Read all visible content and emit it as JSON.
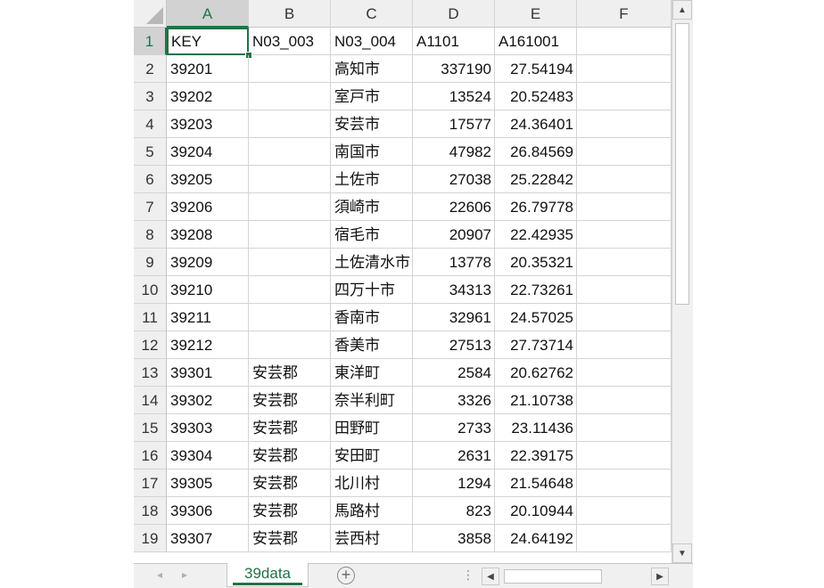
{
  "columns": [
    "A",
    "B",
    "C",
    "D",
    "E",
    "F"
  ],
  "selected_column": "A",
  "selected_row": 1,
  "header_row": [
    "KEY",
    "N03_003",
    "N03_004",
    "A1101",
    "A161001",
    ""
  ],
  "rows": [
    [
      "39201",
      "",
      "高知市",
      "337190",
      "27.54194"
    ],
    [
      "39202",
      "",
      "室戸市",
      "13524",
      "20.52483"
    ],
    [
      "39203",
      "",
      "安芸市",
      "17577",
      "24.36401"
    ],
    [
      "39204",
      "",
      "南国市",
      "47982",
      "26.84569"
    ],
    [
      "39205",
      "",
      "土佐市",
      "27038",
      "25.22842"
    ],
    [
      "39206",
      "",
      "須崎市",
      "22606",
      "26.79778"
    ],
    [
      "39208",
      "",
      "宿毛市",
      "20907",
      "22.42935"
    ],
    [
      "39209",
      "",
      "土佐清水市",
      "13778",
      "20.35321"
    ],
    [
      "39210",
      "",
      "四万十市",
      "34313",
      "22.73261"
    ],
    [
      "39211",
      "",
      "香南市",
      "32961",
      "24.57025"
    ],
    [
      "39212",
      "",
      "香美市",
      "27513",
      "27.73714"
    ],
    [
      "39301",
      "安芸郡",
      "東洋町",
      "2584",
      "20.62762"
    ],
    [
      "39302",
      "安芸郡",
      "奈半利町",
      "3326",
      "21.10738"
    ],
    [
      "39303",
      "安芸郡",
      "田野町",
      "2733",
      "23.11436"
    ],
    [
      "39304",
      "安芸郡",
      "安田町",
      "2631",
      "22.39175"
    ],
    [
      "39305",
      "安芸郡",
      "北川村",
      "1294",
      "21.54648"
    ],
    [
      "39306",
      "安芸郡",
      "馬路村",
      "823",
      "20.10944"
    ],
    [
      "39307",
      "安芸郡",
      "芸西村",
      "3858",
      "24.64192"
    ]
  ],
  "row_numbers": [
    "1",
    "2",
    "3",
    "4",
    "5",
    "6",
    "7",
    "8",
    "9",
    "10",
    "11",
    "12",
    "13",
    "14",
    "15",
    "16",
    "17",
    "18",
    "19"
  ],
  "sheet_tab": "39data",
  "icons": {
    "scroll_up": "▲",
    "scroll_down": "▼",
    "scroll_left": "◀",
    "scroll_right": "▶",
    "tab_prev": "◂",
    "tab_next": "▸",
    "add_sheet": "⊕",
    "more": "⋮"
  },
  "colors": {
    "accent": "#217346",
    "header_bg": "#efefef",
    "gridline": "#d4d4d4"
  }
}
